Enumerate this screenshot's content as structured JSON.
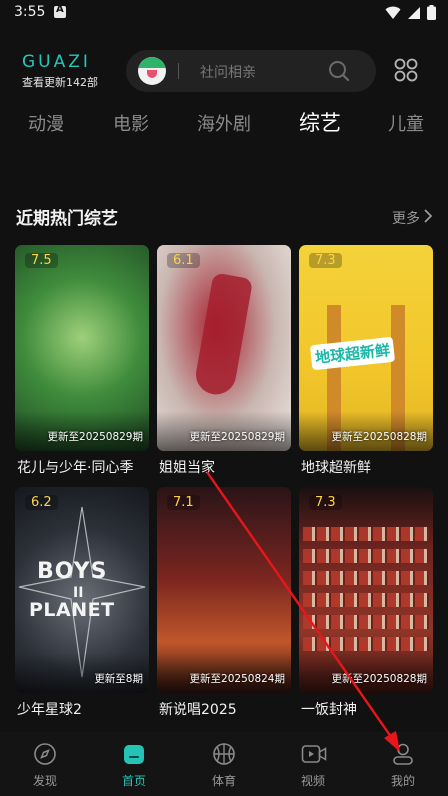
{
  "status_bar": {
    "time": "3:55"
  },
  "header": {
    "brand": "GUAZI",
    "brand_subtitle": "查看更新142部",
    "search_placeholder": "社问相亲"
  },
  "tabs": [
    {
      "label": "动漫",
      "active": false
    },
    {
      "label": "电影",
      "active": false
    },
    {
      "label": "海外剧",
      "active": false
    },
    {
      "label": "综艺",
      "active": true
    },
    {
      "label": "儿童",
      "active": false
    }
  ],
  "section": {
    "title": "近期热门综艺",
    "more_label": "更多"
  },
  "cards": [
    {
      "title": "花儿与少年·同心季",
      "rating": "7.5",
      "update": "更新至20250829期"
    },
    {
      "title": "姐姐当家",
      "rating": "6.1",
      "update": "更新至20250829期"
    },
    {
      "title": "地球超新鲜",
      "rating": "7.3",
      "update": "更新至20250828期"
    },
    {
      "title": "少年星球2",
      "rating": "6.2",
      "update": "更新至8期"
    },
    {
      "title": "新说唱2025",
      "rating": "7.1",
      "update": "更新至20250824期"
    },
    {
      "title": "一饭封神",
      "rating": "7.3",
      "update": "更新至20250828期"
    }
  ],
  "poster_text": {
    "boys": "BOYS",
    "boys_ii": "II",
    "planet": "PLANET",
    "earth": "地球超新鲜"
  },
  "bottom_nav": [
    {
      "label": "发现",
      "icon": "compass-icon",
      "active": false
    },
    {
      "label": "首页",
      "icon": "home-icon",
      "active": true
    },
    {
      "label": "体育",
      "icon": "basketball-icon",
      "active": false
    },
    {
      "label": "视频",
      "icon": "video-icon",
      "active": false
    },
    {
      "label": "我的",
      "icon": "user-icon",
      "active": false
    }
  ],
  "colors": {
    "accent": "#24c3b5",
    "rating": "#ffd24a",
    "annotation": "#e8161b"
  }
}
